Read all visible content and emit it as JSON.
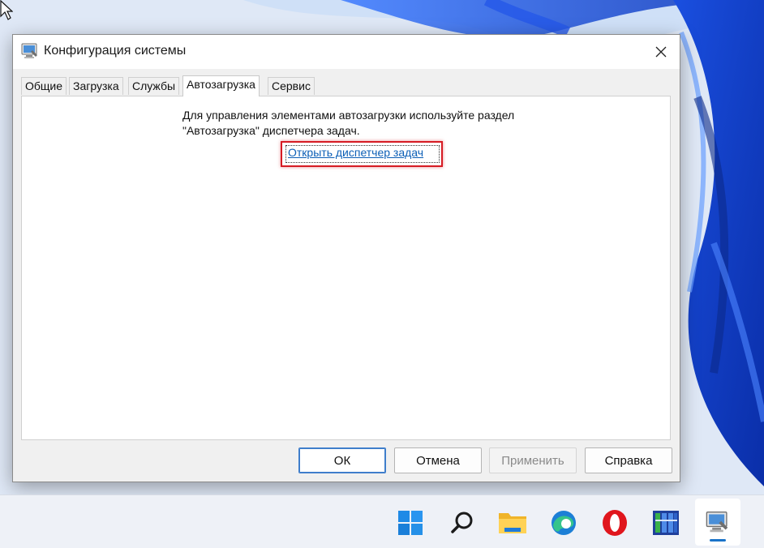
{
  "window": {
    "title": "Конфигурация системы",
    "close_symbol": "✕"
  },
  "tabs": [
    {
      "label": "Общие",
      "active": false
    },
    {
      "label": "Загрузка",
      "active": false
    },
    {
      "label": "Службы",
      "active": false
    },
    {
      "label": "Автозагрузка",
      "active": true
    },
    {
      "label": "Сервис",
      "active": false
    }
  ],
  "startup_panel": {
    "line1": "Для управления элементами автозагрузки используйте раздел",
    "line2": "\"Автозагрузка\" диспетчера задач.",
    "link": "Открыть диспетчер задач"
  },
  "buttons": {
    "ok": "ОК",
    "cancel": "Отмена",
    "apply": "Применить",
    "help": "Справка"
  },
  "taskbar": {
    "icons": [
      "start-icon",
      "search-icon",
      "file-explorer-icon",
      "edge-icon",
      "opera-icon",
      "app-icon",
      "system-configuration-icon"
    ]
  },
  "colors": {
    "accent": "#1a73c9",
    "highlight": "#d61b23",
    "link": "#0c5fb6"
  }
}
